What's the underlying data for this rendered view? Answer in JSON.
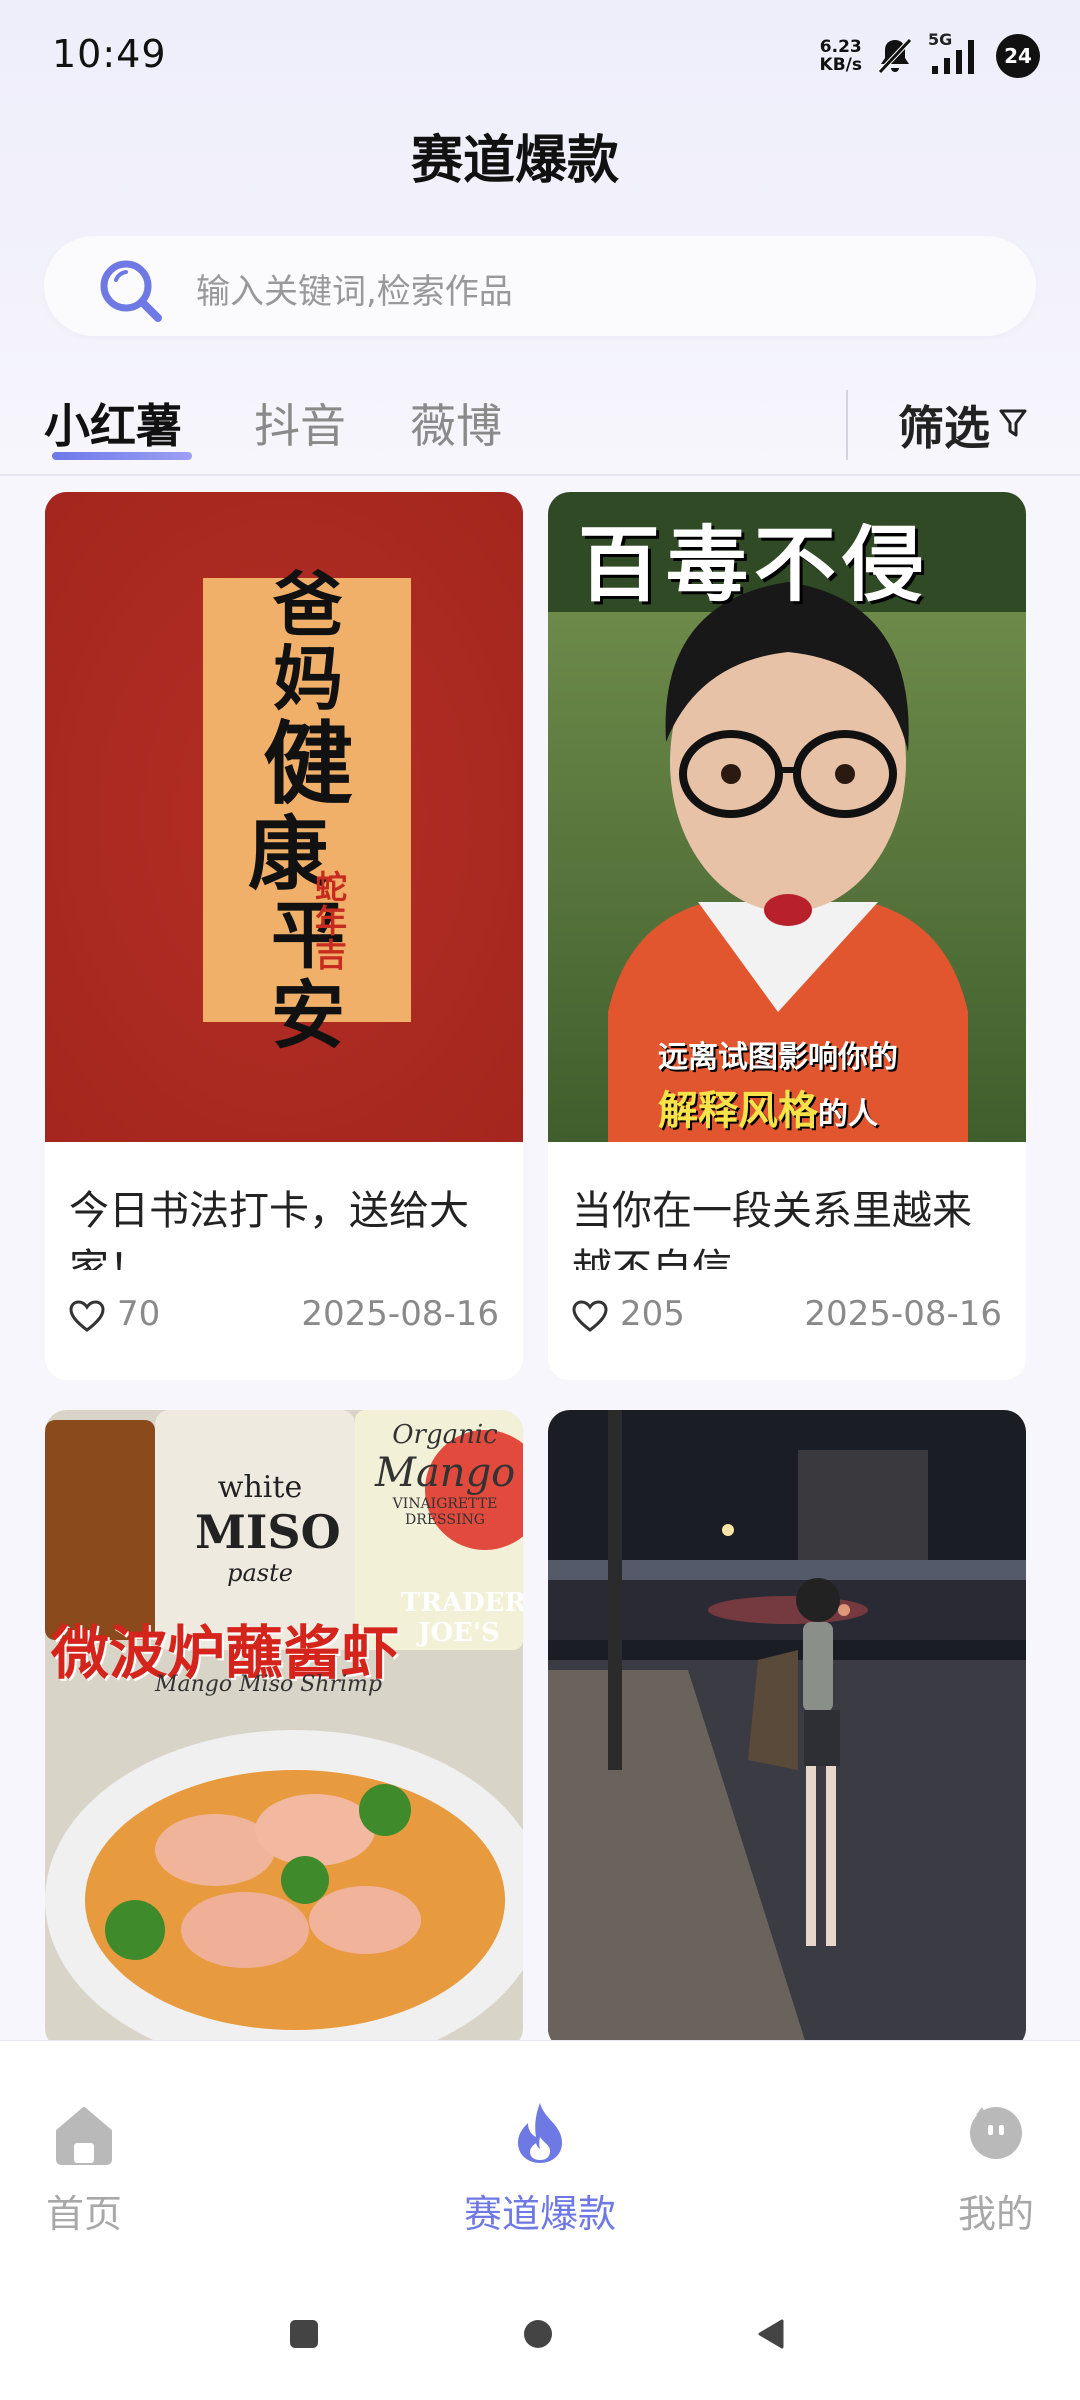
{
  "status_bar": {
    "time": "10:49",
    "net_speed_value": "6.23",
    "net_speed_unit": "KB/s",
    "network": "5G",
    "battery": "24"
  },
  "header": {
    "title": "赛道爆款"
  },
  "search": {
    "placeholder": "输入关键词,检索作品"
  },
  "tabs": [
    {
      "label": "小红薯",
      "active": true
    },
    {
      "label": "抖音",
      "active": false
    },
    {
      "label": "薇博",
      "active": false
    }
  ],
  "filter": {
    "label": "筛选"
  },
  "cards": [
    {
      "title": "今日书法打卡，送给大家！",
      "likes": "70",
      "date": "2025-08-16",
      "image": {
        "lines": [
          "爸",
          "妈",
          "健",
          "康",
          "平",
          "安"
        ],
        "seal": "蛇年吉"
      }
    },
    {
      "title": "当你在一段关系里越来越不自信",
      "likes": "205",
      "date": "2025-08-16",
      "image": {
        "headline": "百毒不侵",
        "caption_line1": "远离试图影响你的",
        "caption_highlight": "解释风格",
        "caption_tail": "的人"
      }
    },
    {
      "title": "",
      "likes": "",
      "date": "",
      "image": {
        "headline": "微波炉蘸酱虾",
        "script": "Mango Miso Shrimp",
        "brand1": "TRADER",
        "brand2": "JOE'S",
        "jar1": "white",
        "jar2": "MISO",
        "jar3": "paste",
        "bottle1": "Organic",
        "bottle2": "Mango",
        "bottle3": "VINAIGRETTE",
        "bottle4": "DRESSING"
      }
    },
    {
      "title": "",
      "likes": "",
      "date": "",
      "image": {}
    }
  ],
  "bottom_nav": [
    {
      "label": "首页",
      "icon": "home-icon",
      "active": false
    },
    {
      "label": "赛道爆款",
      "icon": "flame-icon",
      "active": true
    },
    {
      "label": "我的",
      "icon": "profile-icon",
      "active": false
    }
  ],
  "colors": {
    "accent": "#6f79e3",
    "card1_bg": "#b32b22",
    "calligraphy_panel": "#f0b06a"
  }
}
